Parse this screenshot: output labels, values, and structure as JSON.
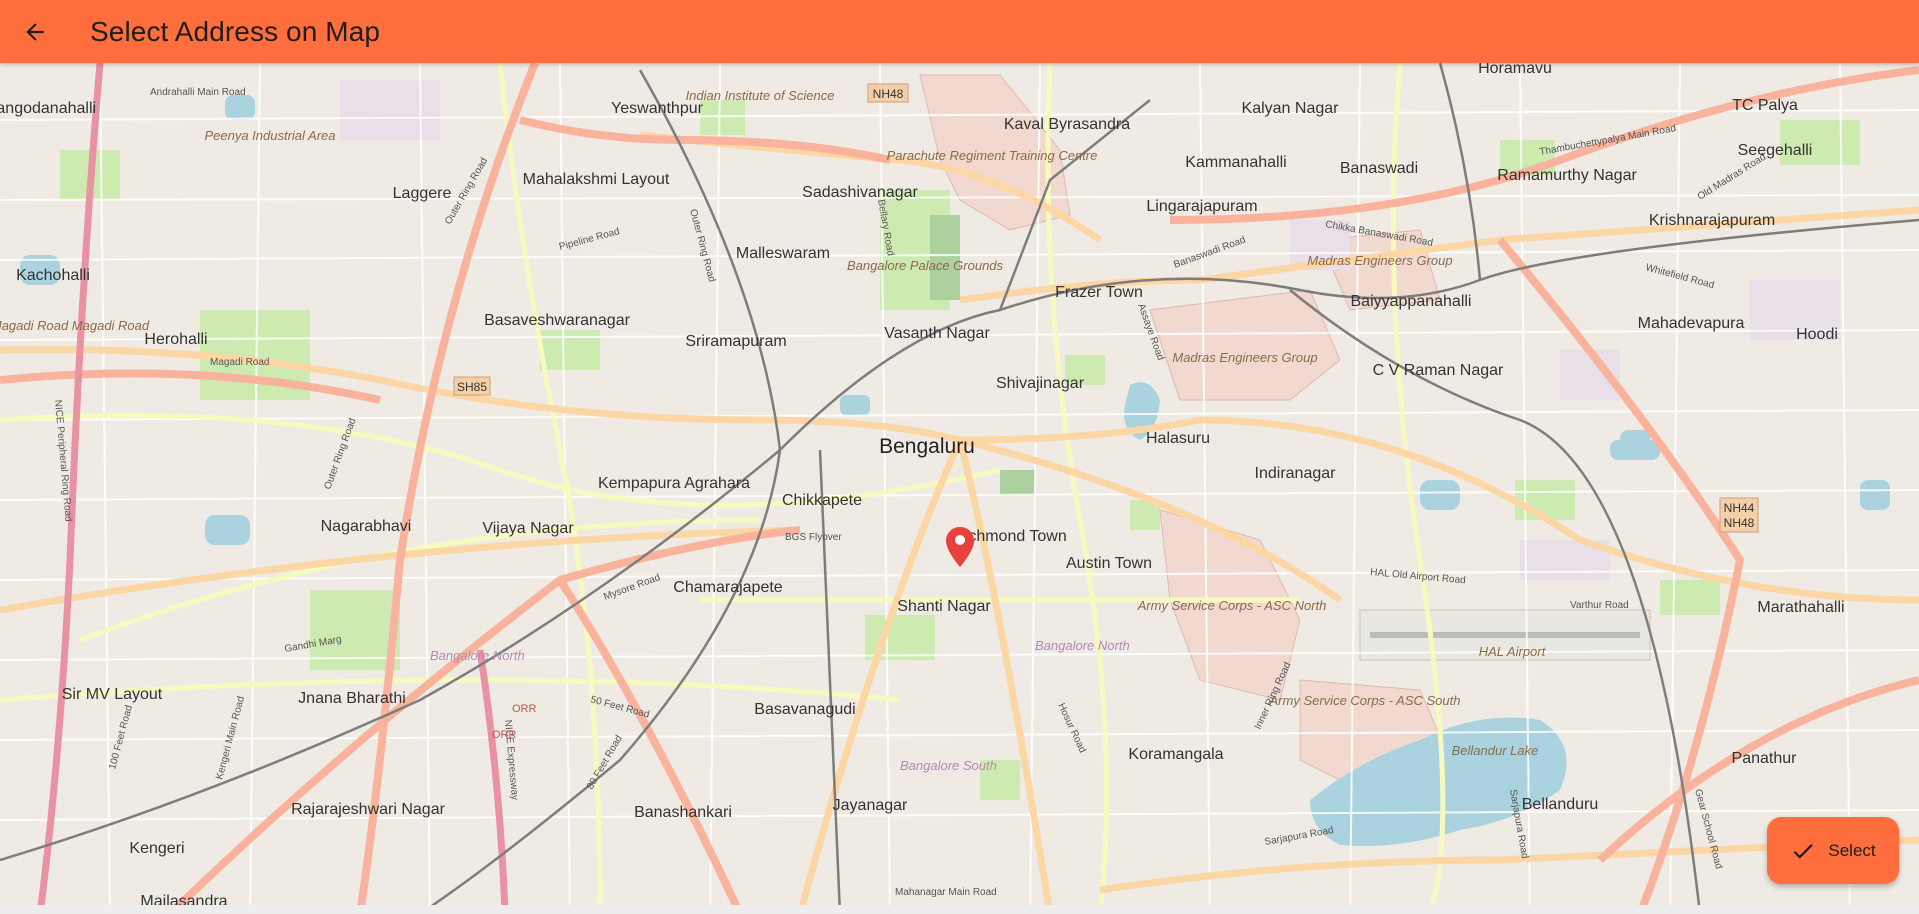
{
  "header": {
    "title": "Select Address on Map",
    "back_icon": "arrow-back-icon"
  },
  "map": {
    "city_label": "Bengaluru",
    "places": [
      "Yeswanthpur",
      "Kaval Byrasandra",
      "Kalyan Nagar",
      "Horamavu",
      "TC Palya",
      "Mahalakshmi Layout",
      "Laggere",
      "Sadashivanagar",
      "Kammanahalli",
      "Banaswadi",
      "Ramamurthy Nagar",
      "Seegehalli",
      "Gangodanahalli",
      "Malleswaram",
      "Lingarajapuram",
      "Krishnarajapuram",
      "Kachohalli",
      "Basaveshwaranagar",
      "Sriramapuram",
      "Frazer Town",
      "Baiyyappanahalli",
      "Mahadevapura",
      "Hoodi",
      "Herohalli",
      "Vasanth Nagar",
      "Shivajinagar",
      "C V Raman Nagar",
      "Halasuru",
      "Indiranagar",
      "Kempapura Agrahara",
      "Chikkapete",
      "Nagarabhavi",
      "Vijaya Nagar",
      "Richmond Town",
      "Austin Town",
      "Chamarajapete",
      "Shanti Nagar",
      "Marathahalli",
      "Sir MV Layout",
      "Jnana Bharathi",
      "Basavanagudi",
      "Koramangala",
      "Panathur",
      "Rajarajeshwari Nagar",
      "Banashankari",
      "Jayanagar",
      "Bellanduru",
      "Kengeri",
      "Mailasandra"
    ],
    "areas": [
      "Indian Institute of Science",
      "Peenya Industrial Area",
      "Parachute Regiment Training Centre",
      "Bangalore Palace Grounds",
      "Madras Engineers Group",
      "Madras Engineers Group",
      "Army Service Corps - ASC North",
      "Army Service Corps - ASC South",
      "HAL Airport",
      "Bellandur Lake",
      "Magadi Road Magadi Road"
    ],
    "roads": [
      "Outer Ring Road",
      "Andrahalli Main Road",
      "Pipeline Road",
      "Magadi Road",
      "Mysore Road",
      "Bellary Road",
      "Chikka Banaswadi Road",
      "Old Madras Road",
      "Whitefield Road",
      "Thambuchettypalya Main Road",
      "HAL Old Airport Road",
      "Varthur Road",
      "Sarjapura Road",
      "Hosur Road",
      "Inner Ring Road",
      "NICE Peripheral Ring Road",
      "NICE Expressway",
      "Gandhi Marg",
      "50 Feet Road",
      "80 Feet Road",
      "100 Feet Road",
      "BGS Flyover",
      "Kengeri Main Road",
      "Outer Ring Road",
      "Banaswadi Road",
      "Assaye Road",
      "Mahanagar Main Road",
      "Outer Ring Road",
      "Gear School Road",
      "Sarjapura Road"
    ],
    "shields": [
      "NH48",
      "SH85",
      "NH44",
      "NH48",
      "ORR",
      "ORR"
    ],
    "region_labels": [
      "Bangalore North",
      "Bangalore North",
      "Bangalore South"
    ],
    "marker_icon": "map-pin-icon",
    "colors": {
      "base": "#f2efe9",
      "park": "#c8facc",
      "military": "#f1d9d0",
      "water": "#aad3df",
      "major_road": "#fcd6a4",
      "trunk_road": "#f9b29c",
      "motorway": "#e892a2",
      "rail": "#8a8a8a",
      "marker": "#e8413c"
    }
  },
  "actions": {
    "select_label": "Select",
    "select_icon": "check-icon"
  },
  "theme": {
    "accent": "#ff6e3c"
  }
}
